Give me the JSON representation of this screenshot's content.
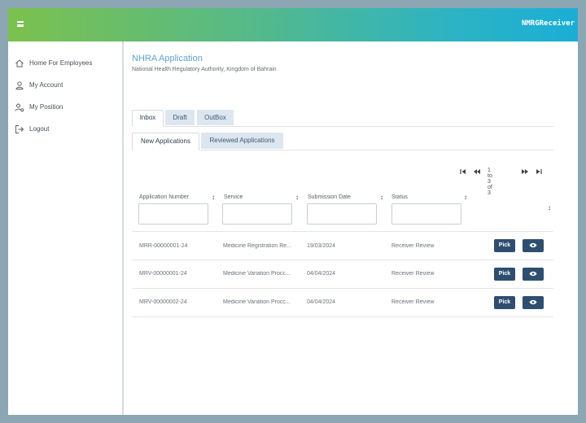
{
  "header": {
    "username": "NMRGReceiver"
  },
  "sidebar": {
    "items": [
      {
        "label": "Home For Employees",
        "icon": "home-icon"
      },
      {
        "label": "My Account",
        "icon": "user-icon"
      },
      {
        "label": "My Position",
        "icon": "user-cog-icon"
      },
      {
        "label": "Logout",
        "icon": "logout-icon"
      }
    ]
  },
  "page": {
    "title": "NHRA Application",
    "subtitle": "National Health Regulatory Authority, Kingdom of Bahrain"
  },
  "tabs": [
    "Inbox",
    "Draft",
    "OutBox"
  ],
  "active_tab": "Inbox",
  "subtabs": [
    "New Applications",
    "Reviewed Applications"
  ],
  "active_subtab": "New Applications",
  "pagination": {
    "text": "1 to 3 of 3"
  },
  "table": {
    "columns": [
      "Application Number",
      "Service",
      "Submission Date",
      "Status"
    ],
    "rows": [
      {
        "app_no": "MRR-00000001-24",
        "service": "Medicine Registration Re...",
        "date": "19/03/2024",
        "status": "Receiver Review",
        "action": "Pick"
      },
      {
        "app_no": "MRV-00000001-24",
        "service": "Medicine Variation Procc...",
        "date": "04/04/2024",
        "status": "Receiver Review",
        "action": "Pick"
      },
      {
        "app_no": "MRV-00000002-24",
        "service": "Medicine Variation Procc...",
        "date": "04/04/2024",
        "status": "Receiver Review",
        "action": "Pick"
      }
    ]
  },
  "colors": {
    "accent_start": "#7cc14d",
    "accent_end": "#1aaed6",
    "button": "#2e4e70",
    "title": "#5aa5cf"
  }
}
